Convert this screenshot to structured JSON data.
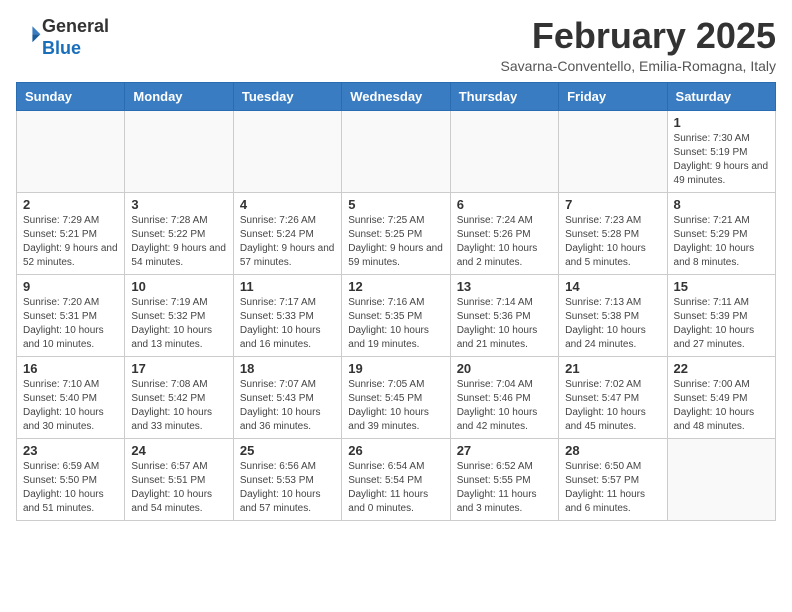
{
  "logo": {
    "general": "General",
    "blue": "Blue"
  },
  "header": {
    "title": "February 2025",
    "subtitle": "Savarna-Conventello, Emilia-Romagna, Italy"
  },
  "weekdays": [
    "Sunday",
    "Monday",
    "Tuesday",
    "Wednesday",
    "Thursday",
    "Friday",
    "Saturday"
  ],
  "weeks": [
    [
      {
        "day": "",
        "info": ""
      },
      {
        "day": "",
        "info": ""
      },
      {
        "day": "",
        "info": ""
      },
      {
        "day": "",
        "info": ""
      },
      {
        "day": "",
        "info": ""
      },
      {
        "day": "",
        "info": ""
      },
      {
        "day": "1",
        "info": "Sunrise: 7:30 AM\nSunset: 5:19 PM\nDaylight: 9 hours and 49 minutes."
      }
    ],
    [
      {
        "day": "2",
        "info": "Sunrise: 7:29 AM\nSunset: 5:21 PM\nDaylight: 9 hours and 52 minutes."
      },
      {
        "day": "3",
        "info": "Sunrise: 7:28 AM\nSunset: 5:22 PM\nDaylight: 9 hours and 54 minutes."
      },
      {
        "day": "4",
        "info": "Sunrise: 7:26 AM\nSunset: 5:24 PM\nDaylight: 9 hours and 57 minutes."
      },
      {
        "day": "5",
        "info": "Sunrise: 7:25 AM\nSunset: 5:25 PM\nDaylight: 9 hours and 59 minutes."
      },
      {
        "day": "6",
        "info": "Sunrise: 7:24 AM\nSunset: 5:26 PM\nDaylight: 10 hours and 2 minutes."
      },
      {
        "day": "7",
        "info": "Sunrise: 7:23 AM\nSunset: 5:28 PM\nDaylight: 10 hours and 5 minutes."
      },
      {
        "day": "8",
        "info": "Sunrise: 7:21 AM\nSunset: 5:29 PM\nDaylight: 10 hours and 8 minutes."
      }
    ],
    [
      {
        "day": "9",
        "info": "Sunrise: 7:20 AM\nSunset: 5:31 PM\nDaylight: 10 hours and 10 minutes."
      },
      {
        "day": "10",
        "info": "Sunrise: 7:19 AM\nSunset: 5:32 PM\nDaylight: 10 hours and 13 minutes."
      },
      {
        "day": "11",
        "info": "Sunrise: 7:17 AM\nSunset: 5:33 PM\nDaylight: 10 hours and 16 minutes."
      },
      {
        "day": "12",
        "info": "Sunrise: 7:16 AM\nSunset: 5:35 PM\nDaylight: 10 hours and 19 minutes."
      },
      {
        "day": "13",
        "info": "Sunrise: 7:14 AM\nSunset: 5:36 PM\nDaylight: 10 hours and 21 minutes."
      },
      {
        "day": "14",
        "info": "Sunrise: 7:13 AM\nSunset: 5:38 PM\nDaylight: 10 hours and 24 minutes."
      },
      {
        "day": "15",
        "info": "Sunrise: 7:11 AM\nSunset: 5:39 PM\nDaylight: 10 hours and 27 minutes."
      }
    ],
    [
      {
        "day": "16",
        "info": "Sunrise: 7:10 AM\nSunset: 5:40 PM\nDaylight: 10 hours and 30 minutes."
      },
      {
        "day": "17",
        "info": "Sunrise: 7:08 AM\nSunset: 5:42 PM\nDaylight: 10 hours and 33 minutes."
      },
      {
        "day": "18",
        "info": "Sunrise: 7:07 AM\nSunset: 5:43 PM\nDaylight: 10 hours and 36 minutes."
      },
      {
        "day": "19",
        "info": "Sunrise: 7:05 AM\nSunset: 5:45 PM\nDaylight: 10 hours and 39 minutes."
      },
      {
        "day": "20",
        "info": "Sunrise: 7:04 AM\nSunset: 5:46 PM\nDaylight: 10 hours and 42 minutes."
      },
      {
        "day": "21",
        "info": "Sunrise: 7:02 AM\nSunset: 5:47 PM\nDaylight: 10 hours and 45 minutes."
      },
      {
        "day": "22",
        "info": "Sunrise: 7:00 AM\nSunset: 5:49 PM\nDaylight: 10 hours and 48 minutes."
      }
    ],
    [
      {
        "day": "23",
        "info": "Sunrise: 6:59 AM\nSunset: 5:50 PM\nDaylight: 10 hours and 51 minutes."
      },
      {
        "day": "24",
        "info": "Sunrise: 6:57 AM\nSunset: 5:51 PM\nDaylight: 10 hours and 54 minutes."
      },
      {
        "day": "25",
        "info": "Sunrise: 6:56 AM\nSunset: 5:53 PM\nDaylight: 10 hours and 57 minutes."
      },
      {
        "day": "26",
        "info": "Sunrise: 6:54 AM\nSunset: 5:54 PM\nDaylight: 11 hours and 0 minutes."
      },
      {
        "day": "27",
        "info": "Sunrise: 6:52 AM\nSunset: 5:55 PM\nDaylight: 11 hours and 3 minutes."
      },
      {
        "day": "28",
        "info": "Sunrise: 6:50 AM\nSunset: 5:57 PM\nDaylight: 11 hours and 6 minutes."
      },
      {
        "day": "",
        "info": ""
      }
    ]
  ]
}
